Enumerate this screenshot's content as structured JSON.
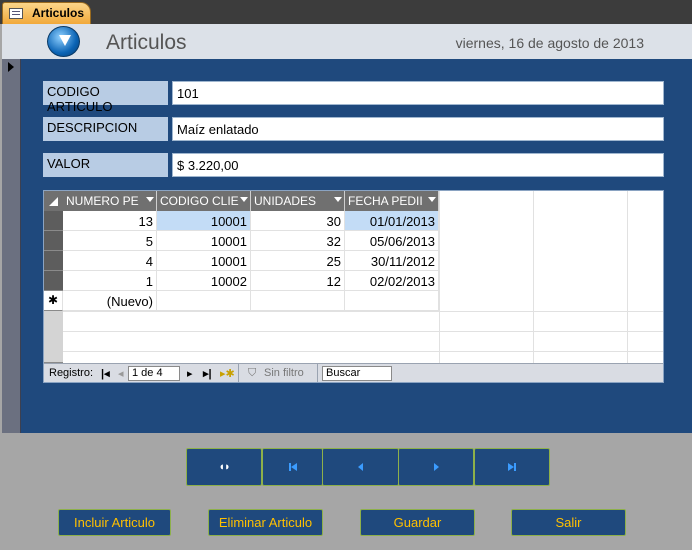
{
  "tab": {
    "label": "Articulos"
  },
  "header": {
    "title": "Articulos",
    "date": "viernes, 16 de agosto de 2013"
  },
  "fields": [
    {
      "label": "CODIGO ARTICULO",
      "value": "101"
    },
    {
      "label": "DESCRIPCION",
      "value": "Maíz enlatado"
    },
    {
      "label": "VALOR",
      "value": "$ 3.220,00"
    }
  ],
  "subform": {
    "columns": [
      "NUMERO PE",
      "CODIGO CLIE",
      "UNIDADES",
      "FECHA PEDII"
    ],
    "rows": [
      [
        "13",
        "10001",
        "30",
        "01/01/2013"
      ],
      [
        "5",
        "10001",
        "32",
        "05/06/2013"
      ],
      [
        "4",
        "10001",
        "25",
        "30/11/2012"
      ],
      [
        "1",
        "10002",
        "12",
        "02/02/2013"
      ]
    ],
    "new_row": "(Nuevo)",
    "new_marker": "✱",
    "nav": {
      "registro": "Registro:",
      "position": "1 de 4",
      "filter": "Sin filtro",
      "search": "Buscar"
    }
  },
  "nav_buttons": [
    "find-icon",
    "first-record-icon",
    "previous-record-icon",
    "next-record-icon",
    "last-record-icon"
  ],
  "actions": {
    "add": "Incluir Articulo",
    "delete": "Eliminar Articulo",
    "save": "Guardar",
    "exit": "Salir"
  },
  "colors": {
    "detail_bg": "#1f497d",
    "label_bg": "#b8cce4",
    "button_text": "#ffc000",
    "button_border": "#8db04a"
  }
}
